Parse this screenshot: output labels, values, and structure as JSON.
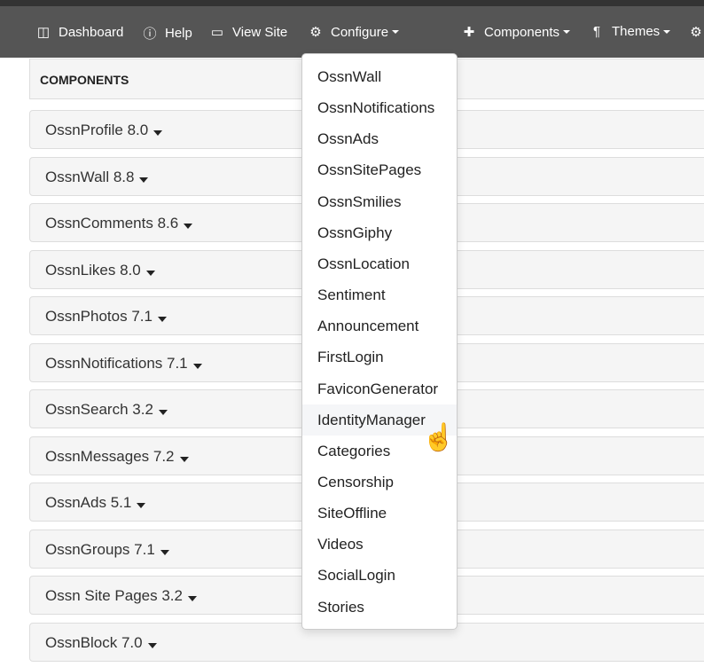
{
  "nav": {
    "items": [
      {
        "label": "Dashboard",
        "icon": "columns-icon"
      },
      {
        "label": "Help",
        "icon": "info-icon"
      },
      {
        "label": "View Site",
        "icon": "laptop-icon"
      },
      {
        "label": "Configure",
        "icon": "cogs-icon",
        "dropdown": true
      },
      {
        "label": "Components",
        "icon": "puzzle-icon",
        "dropdown": true
      },
      {
        "label": "Themes",
        "icon": "paint-roller-icon",
        "dropdown": true
      }
    ]
  },
  "header": "COMPONENTS",
  "components": [
    "OssnProfile 8.0",
    "OssnWall 8.8",
    "OssnComments 8.6",
    "OssnLikes 8.0",
    "OssnPhotos 7.1",
    "OssnNotifications 7.1",
    "OssnSearch 3.2",
    "OssnMessages 7.2",
    "OssnAds 5.1",
    "OssnGroups 7.1",
    "Ossn Site Pages 3.2",
    "OssnBlock 7.0"
  ],
  "dropdown": {
    "hovered": "IdentityManager",
    "items": [
      "OssnWall",
      "OssnNotifications",
      "OssnAds",
      "OssnSitePages",
      "OssnSmilies",
      "OssnGiphy",
      "OssnLocation",
      "Sentiment",
      "Announcement",
      "FirstLogin",
      "FaviconGenerator",
      "IdentityManager",
      "Categories",
      "Censorship",
      "SiteOffline",
      "Videos",
      "SocialLogin",
      "Stories"
    ]
  }
}
